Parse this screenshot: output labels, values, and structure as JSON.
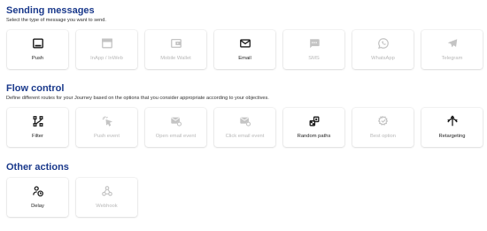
{
  "sending": {
    "title": "Sending messages",
    "subtitle": "Select the type of message you want to send.",
    "items": [
      {
        "label": "Push",
        "icon": "push-icon",
        "enabled": true
      },
      {
        "label": "InApp / InWeb",
        "icon": "inapp-icon",
        "enabled": false
      },
      {
        "label": "Mobile Wallet",
        "icon": "wallet-icon",
        "enabled": false
      },
      {
        "label": "Email",
        "icon": "email-icon",
        "enabled": true
      },
      {
        "label": "SMS",
        "icon": "sms-icon",
        "enabled": false
      },
      {
        "label": "WhatsApp",
        "icon": "whatsapp-icon",
        "enabled": false
      },
      {
        "label": "Telegram",
        "icon": "telegram-icon",
        "enabled": false
      }
    ]
  },
  "flow": {
    "title": "Flow control",
    "subtitle": "Define different routes for your Journey based on the options that you consider appropriate according to your objectives.",
    "items": [
      {
        "label": "Filter",
        "icon": "filter-icon",
        "enabled": true
      },
      {
        "label": "Push event",
        "icon": "push-event-icon",
        "enabled": false
      },
      {
        "label": "Open email event",
        "icon": "open-email-event-icon",
        "enabled": false
      },
      {
        "label": "Click email event",
        "icon": "click-email-event-icon",
        "enabled": false
      },
      {
        "label": "Random paths",
        "icon": "random-paths-icon",
        "enabled": true
      },
      {
        "label": "Best option",
        "icon": "best-option-icon",
        "enabled": false
      },
      {
        "label": "Retargeting",
        "icon": "retargeting-icon",
        "enabled": true
      }
    ]
  },
  "other": {
    "title": "Other actions",
    "items": [
      {
        "label": "Delay",
        "icon": "delay-icon",
        "enabled": true
      },
      {
        "label": "Webhook",
        "icon": "webhook-icon",
        "enabled": false
      }
    ]
  },
  "colors": {
    "heading": "#1b3a8c",
    "enabled_text": "#222222",
    "disabled_text": "#b8b8b8",
    "enabled_icon": "#1c1c1c",
    "disabled_icon": "#c4c4c4"
  }
}
